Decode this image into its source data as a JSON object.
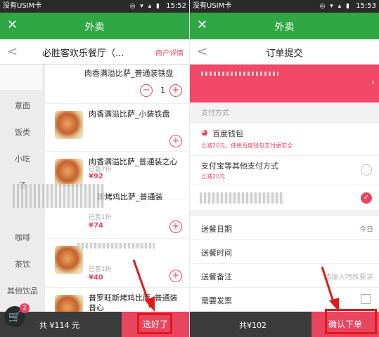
{
  "status": {
    "carrier": "没有USIM卡",
    "time_left": "15:52",
    "time_right": "15:53",
    "icons": "◎ ▾ ▴ ▮"
  },
  "left": {
    "app_title": "外卖",
    "restaurant": "必胜客欢乐餐厅（...",
    "merchant_link": "商户详情",
    "categories": [
      "意面",
      "饭类",
      "小吃",
      "汤",
      "咖啡",
      "茶饮",
      "其他饮品"
    ],
    "top_item": {
      "name": "肉香满溢比萨_普通装铁盘",
      "qty": "1"
    },
    "items": [
      {
        "name": "肉香满溢比萨_小装铁盘",
        "sold": "",
        "price": ""
      },
      {
        "name": "肉香满溢比萨_普通装之心",
        "sold": "已售7份",
        "price": "¥92"
      },
      {
        "name": "斯烤鸡比萨_普通装",
        "sold": "已售1份",
        "price": "¥74"
      },
      {
        "name": "",
        "sold": "已售1份",
        "price": "¥40"
      },
      {
        "name": "普罗旺斯烤鸡比萨_普通装",
        "sold": "",
        "price": ""
      },
      {
        "name": "普心",
        "sold": "",
        "price": ""
      }
    ],
    "cart_count": "2",
    "total": "共 ¥114 元",
    "button": "选好了"
  },
  "right": {
    "app_title": "外卖",
    "page_title": "订单提交",
    "pay_header": "支付方式",
    "baidu_wallet": "百度钱包",
    "baidu_promo": "立减20元，使用百度钱包支付更安全",
    "alipay": "支付宝等其他支付方式",
    "alipay_promo": "立减20元",
    "delivery_date": "送餐日期",
    "delivery_date_value": "今日",
    "delivery_time": "送餐时间",
    "note": "送餐备注",
    "note_placeholder": "请输入特殊要求",
    "invoice": "需要发票",
    "total": "共¥102",
    "button": "确认下单"
  }
}
